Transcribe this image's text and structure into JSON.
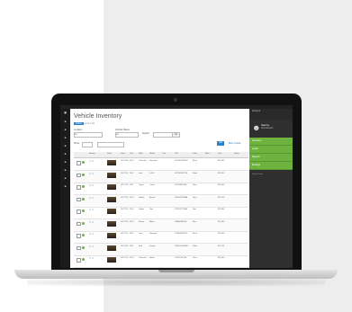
{
  "app": {
    "window_title": "",
    "page_title": "Vehicle Inventory",
    "crumb_active": "Active",
    "crumb_other": "Inventory list"
  },
  "filters": {
    "label_1": "Location",
    "label_2": "Vehicle Status",
    "select_1": "All",
    "select_2": "All",
    "search_label": "Search",
    "show_label": "Show",
    "go_button": "Go"
  },
  "actions": {
    "primary": "Add",
    "secondary": "Bulk Update"
  },
  "table": {
    "headers": [
      "",
      "Actions",
      "Photo",
      "Stock",
      "Year",
      "Make",
      "Model",
      "Trim",
      "VIN",
      "Color",
      "Miles",
      "Price",
      "Status"
    ],
    "rows": [
      {
        "stock": "1427-108",
        "year": "2013",
        "make": "Chevrolet",
        "model": "Silverado",
        "vin": "1GCNCPEX0DZ",
        "color": "Black",
        "price": "$20,000"
      },
      {
        "stock": "1427-121",
        "year": "2012",
        "make": "Ford",
        "model": "F-150",
        "vin": "1FTFW1ET5CK",
        "color": "White",
        "price": "$26,995"
      },
      {
        "stock": "1427-130",
        "year": "2011",
        "make": "Toyota",
        "model": "Camry",
        "vin": "4T1BF3EK1BU",
        "color": "Silver",
        "price": "$14,500"
      },
      {
        "stock": "1427-142",
        "year": "2014",
        "make": "Honda",
        "model": "Accord",
        "vin": "1HGCR2F33EA",
        "color": "Gray",
        "price": "$19,250"
      },
      {
        "stock": "1427-155",
        "year": "2010",
        "make": "Dodge",
        "model": "Ram",
        "vin": "1D7RV1CT4AS",
        "color": "Red",
        "price": "$15,800"
      },
      {
        "stock": "1427-163",
        "year": "2013",
        "make": "Nissan",
        "model": "Altima",
        "vin": "1N4AL3AP6DC",
        "color": "Blue",
        "price": "$13,900"
      },
      {
        "stock": "1427-170",
        "year": "2012",
        "make": "Jeep",
        "model": "Wrangler",
        "vin": "1C4BJWDG2CL",
        "color": "Black",
        "price": "$24,400"
      },
      {
        "stock": "1427-181",
        "year": "2011",
        "make": "Ford",
        "model": "Escape",
        "vin": "1FMCU0DG0BK",
        "color": "White",
        "price": "$11,750"
      },
      {
        "stock": "1427-194",
        "year": "2014",
        "make": "Chevrolet",
        "model": "Malibu",
        "vin": "1G11C5SL2EF",
        "color": "Silver",
        "price": "$16,300"
      }
    ]
  },
  "right_panel": {
    "header": "Account",
    "user_name": "Samra",
    "user_role": "Administrator",
    "menu": [
      "Inventory",
      "Leads",
      "Reports",
      "Settings"
    ],
    "footer": "Dealer Portal"
  },
  "colors": {
    "accent_blue": "#2f7fc3",
    "accent_green": "#6fb33f",
    "dark": "#1b1b1b"
  }
}
